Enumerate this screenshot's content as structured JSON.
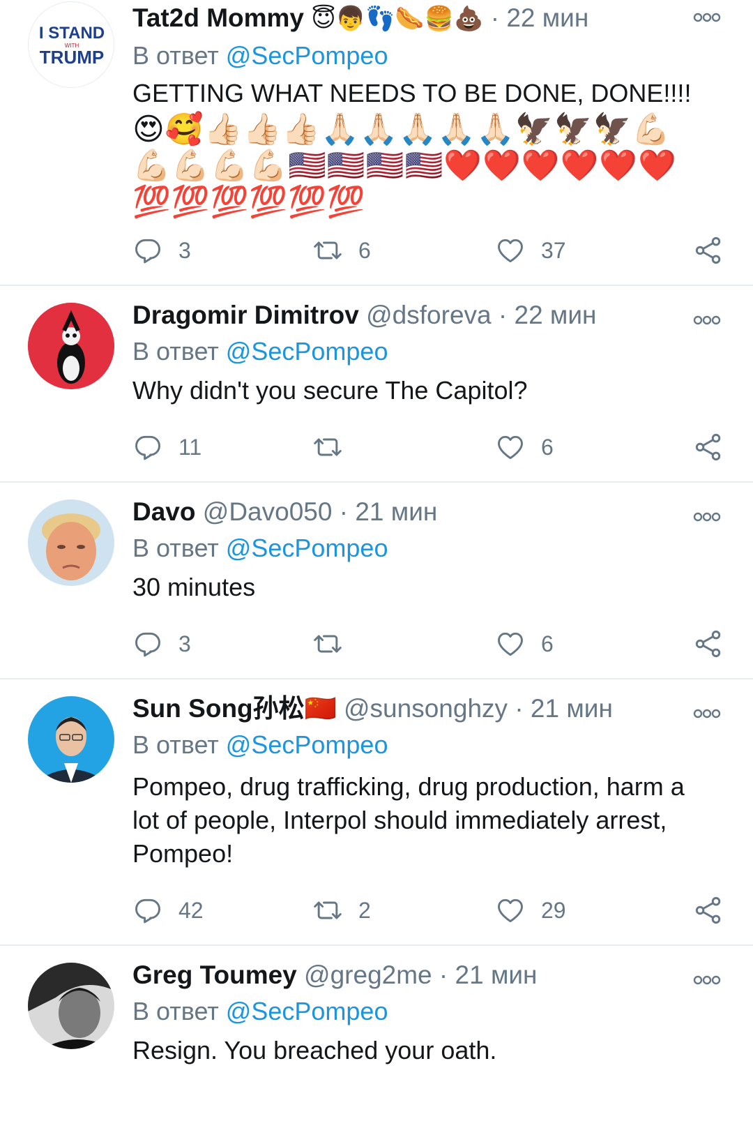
{
  "tweets": [
    {
      "name": "Tat2d Mommy",
      "name_emojis": "😇👦👣🌭🍔💩",
      "handle": "",
      "time": "22 мин",
      "reply_prefix": "В ответ",
      "reply_to": "@SecPompeo",
      "text": "GETTING WHAT NEEDS TO BE DONE, DONE!!!!",
      "emoji_text": "😍🥰👍🏻👍🏻👍🏻🙏🏻🙏🏻🙏🏻🙏🏻🙏🏻🦅🦅🦅💪🏻💪🏻💪🏻💪🏻💪🏻🇺🇸🇺🇸🇺🇸🇺🇸❤️❤️❤️❤️❤️❤️💯💯💯💯💯💯",
      "replies": "3",
      "retweets": "6",
      "likes": "37"
    },
    {
      "name": "Dragomir Dimitrov",
      "handle": "@dsforeva",
      "time": "22 мин",
      "reply_prefix": "В ответ",
      "reply_to": "@SecPompeo",
      "text": "Why didn't you secure The Capitol?",
      "replies": "11",
      "retweets": "",
      "likes": "6"
    },
    {
      "name": "Davo",
      "handle": "@Davo050",
      "time": "21 мин",
      "reply_prefix": "В ответ",
      "reply_to": "@SecPompeo",
      "text": "30 minutes",
      "replies": "3",
      "retweets": "",
      "likes": "6"
    },
    {
      "name": "Sun Song孙松🇨🇳",
      "handle": "@sunsonghzy",
      "time": "21 мин",
      "reply_prefix": "В ответ",
      "reply_to": "@SecPompeo",
      "text": "Pompeo, drug trafficking, drug production, harm a lot of people, Interpol should immediately arrest, Pompeo!",
      "replies": "42",
      "retweets": "2",
      "likes": "29"
    },
    {
      "name": "Greg Toumey",
      "handle": "@greg2me",
      "time": "21 мин",
      "reply_prefix": "В ответ",
      "reply_to": "@SecPompeo",
      "text": "Resign. You breached your oath."
    }
  ],
  "avatars": {
    "tweet1": {
      "line1": "I STAND",
      "line2": "WITH",
      "line3": "TRUMP"
    }
  },
  "separator": "·",
  "colors": {
    "text": "#14171a",
    "muted": "#657786",
    "mention": "#1b95e0",
    "divider": "#e6ecf0"
  },
  "icons": [
    "reply-icon",
    "retweet-icon",
    "like-icon",
    "share-icon",
    "more-icon"
  ]
}
